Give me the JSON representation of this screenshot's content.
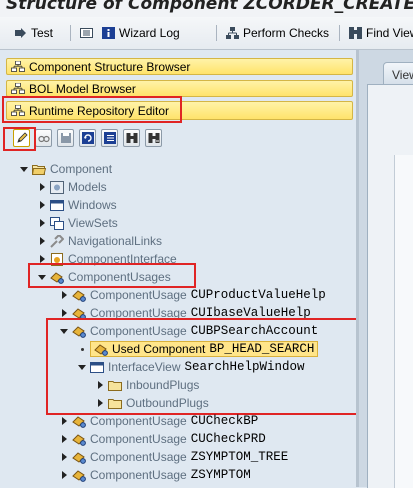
{
  "window": {
    "title": "Structure of Component ZCORDER_CREATE - I"
  },
  "toolbar": {
    "test_label": "Test",
    "wizard_log_label": "Wizard Log",
    "perform_checks_label": "Perform Checks",
    "find_view_label": "Find View"
  },
  "accordion": {
    "component_structure": "Component Structure Browser",
    "bol_model": "BOL Model Browser",
    "runtime_repository": "Runtime Repository Editor"
  },
  "tree": {
    "component": "Component",
    "models": "Models",
    "windows": "Windows",
    "viewsets": "ViewSets",
    "navigational_links": "NavigationalLinks",
    "component_interface": "ComponentInterface",
    "component_usages": "ComponentUsages",
    "usage_prefix": "ComponentUsage",
    "usages": [
      {
        "name": "CUProductValueHelp"
      },
      {
        "name": "CUIbaseValueHelp"
      },
      {
        "name": "CUBPSearchAccount"
      }
    ],
    "used_component_label": "Used Component",
    "used_component_name": "BP_HEAD_SEARCH",
    "interface_view_label": "InterfaceView",
    "interface_view_name": "SearchHelpWindow",
    "inbound_plugs": "InboundPlugs",
    "outbound_plugs": "OutboundPlugs",
    "usages_after": [
      {
        "name": "CUCheckBP"
      },
      {
        "name": "CUCheckPRD"
      },
      {
        "name": "ZSYMPTOM_TREE"
      },
      {
        "name": "ZSYMPTOM"
      }
    ]
  },
  "right_pane": {
    "tab_label": "View"
  },
  "colors": {
    "highlight_red": "#e02424",
    "accordion_yellow": "#ffe36b",
    "selected_node": "#ffe58a"
  }
}
